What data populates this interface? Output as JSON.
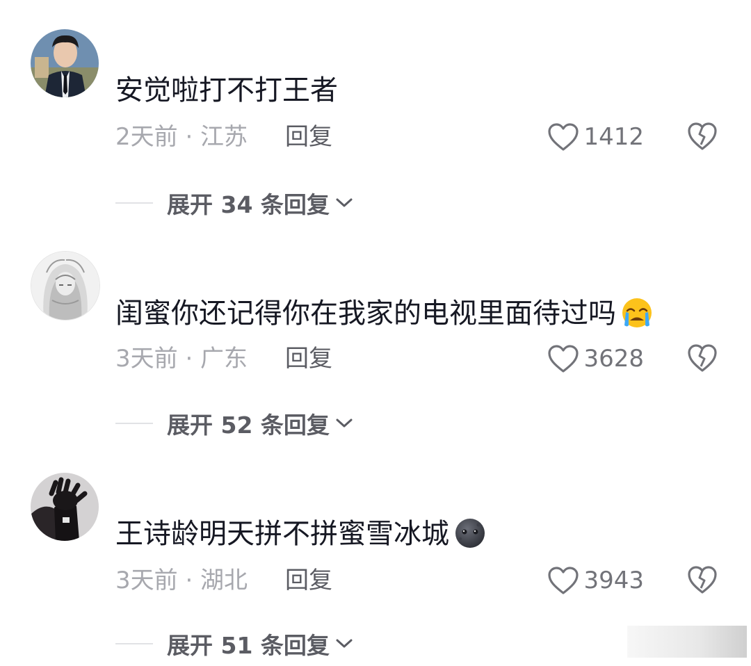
{
  "comments": [
    {
      "text": "安觉啦打不打王者",
      "meta": "2天前 · 江苏",
      "reply_label": "回复",
      "likes": "1412",
      "expand_label": "展开 34 条回复",
      "avatar": "photo-man-in-suit",
      "emoji": ""
    },
    {
      "text": "闺蜜你还记得你在我家的电视里面待过吗",
      "meta": "3天前 · 广东",
      "reply_label": "回复",
      "likes": "3628",
      "expand_label": "展开 52 条回复",
      "avatar": "sketch-anime-girl",
      "emoji": "crying-face-emoji"
    },
    {
      "text": "王诗龄明天拼不拼蜜雪冰城",
      "meta": "3天前 · 湖北",
      "reply_label": "回复",
      "likes": "3943",
      "expand_label": "展开 51 条回复",
      "avatar": "dark-hand-photo",
      "emoji": "dark-moon-face-emoji"
    }
  ],
  "icons": {
    "like": "heart-outline-icon",
    "dislike": "broken-heart-icon",
    "expand": "chevron-down-icon"
  },
  "colors": {
    "primary_text": "#161823",
    "meta_text": "#a7a8ae",
    "reply_text": "#5b5c63",
    "icon": "#727379"
  }
}
